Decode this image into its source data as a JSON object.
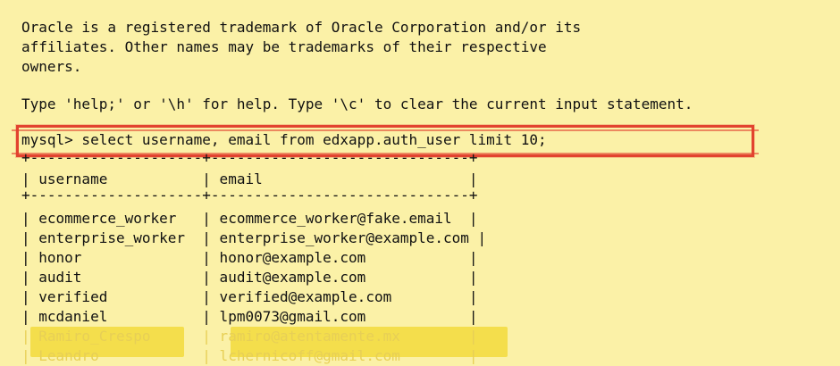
{
  "terminal": {
    "lines": [
      "Oracle is a registered trademark of Oracle Corporation and/or its",
      "affiliates. Other names may be trademarks of their respective",
      "owners.",
      "",
      "Type 'help;' or '\\h' for help. Type '\\c' to clear the current input statement.",
      ""
    ],
    "command": "mysql> select username, email from edxapp.auth_user limit 10;",
    "table": {
      "border": "+--------------------+------------------------------+",
      "header": "| username           | email                        |",
      "rows": [
        "| ecommerce_worker   | ecommerce_worker@fake.email  |",
        "| enterprise_worker  | enterprise_worker@example.com |",
        "| honor              | honor@example.com            |",
        "| audit              | audit@example.com            |",
        "| verified           | verified@example.com         |",
        "| mcdaniel           | lpm0073@gmail.com            |",
        "| Ramiro_Crespo      | ramiro@atentamente.mx        |",
        "| Leandro            | lchernicoff@gmail.com        |"
      ]
    },
    "colors": {
      "background": "#fbf1a7",
      "highlight_border": "#e2432f",
      "redaction": "#f4de4c"
    }
  }
}
